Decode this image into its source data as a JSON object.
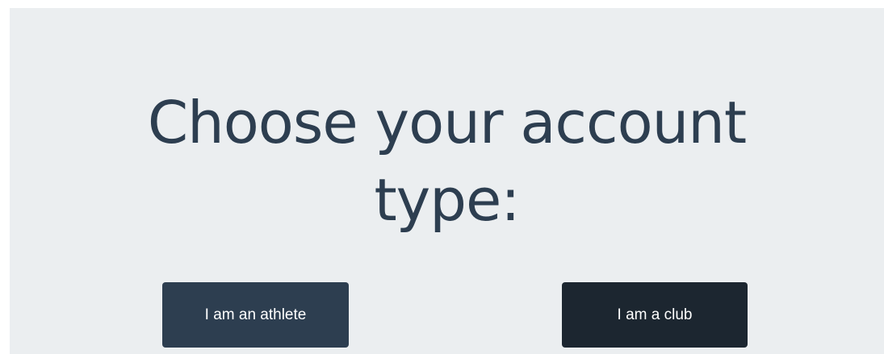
{
  "heading": {
    "text": "Choose your account type:"
  },
  "buttons": {
    "athlete_label": "I am an athlete",
    "club_label": "I am a club"
  },
  "colors": {
    "background": "#ebeef0",
    "heading_text": "#2d3e50",
    "athlete_button": "#2d3e50",
    "club_button": "#1c2630",
    "button_text": "#ffffff"
  }
}
